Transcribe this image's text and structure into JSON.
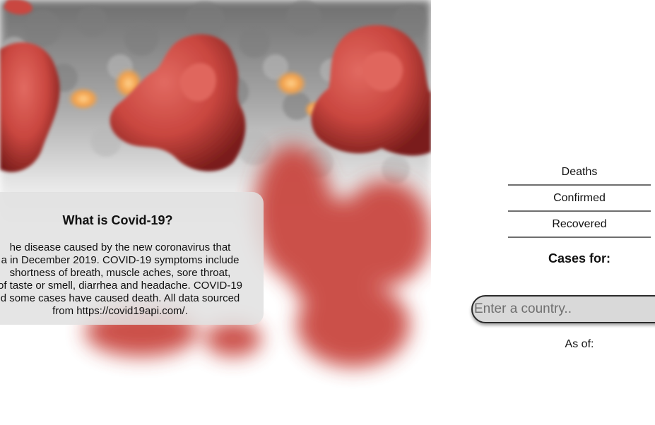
{
  "hero": {
    "image": "coronavirus-illustration",
    "colors": {
      "spike": "#c9463f",
      "spike_dark": "#8e2320",
      "membrane": "#9c9c9c",
      "glow": "#f2a04a"
    }
  },
  "info": {
    "title": "What is Covid-19?",
    "lines": [
      "he disease caused by the new coronavirus that",
      "a in December 2019. COVID-19 symptoms include",
      "shortness of breath, muscle aches, sore throat,",
      "of taste or smell, diarrhea and headache. COVID-19",
      "d some cases have caused death. All data sourced",
      "from https://covid19api.com/."
    ]
  },
  "stats": {
    "deaths_label": "Deaths",
    "confirmed_label": "Confirmed",
    "recovered_label": "Recovered"
  },
  "cases": {
    "title": "Cases for:",
    "search_placeholder": "Enter a country..",
    "as_of_label": "As of:"
  }
}
